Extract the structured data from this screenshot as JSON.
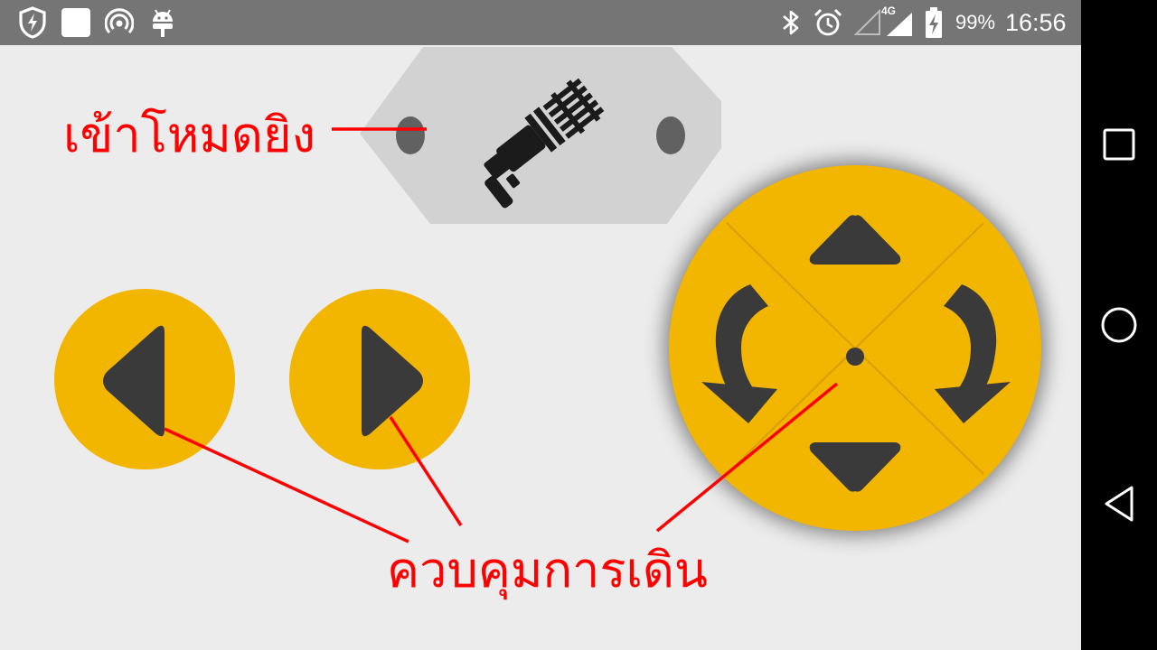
{
  "status_bar": {
    "battery_percent": "99%",
    "time": "16:56",
    "network_label": "4G",
    "left_icons": [
      "shield-bolt-icon",
      "white-square-icon",
      "hotspot-icon",
      "android-icon"
    ],
    "right_icons": [
      "bluetooth-icon",
      "alarm-icon",
      "signal-empty-icon",
      "signal-4g-icon",
      "battery-charging-icon"
    ]
  },
  "nav_bar": {
    "buttons": [
      "recents-square-icon",
      "home-circle-icon",
      "back-triangle-icon"
    ]
  },
  "controls": {
    "fire_mode_button_icon": "gatling-gun-icon",
    "left_button_icon": "left-arrow-icon",
    "right_button_icon": "right-arrow-icon",
    "dpad_icons": [
      "up-arrow-icon",
      "down-arrow-icon",
      "rotate-left-icon",
      "rotate-right-icon"
    ]
  },
  "annotations": {
    "fire_mode_label": "เข้าโหมดยิง",
    "movement_label": "ควบคุมการเดิน",
    "color": "#ff0000"
  },
  "colors": {
    "button_yellow": "#f2b500",
    "icon_dark": "#3a3a3a",
    "status_bar_bg": "#757575",
    "app_bg": "#ececec"
  }
}
